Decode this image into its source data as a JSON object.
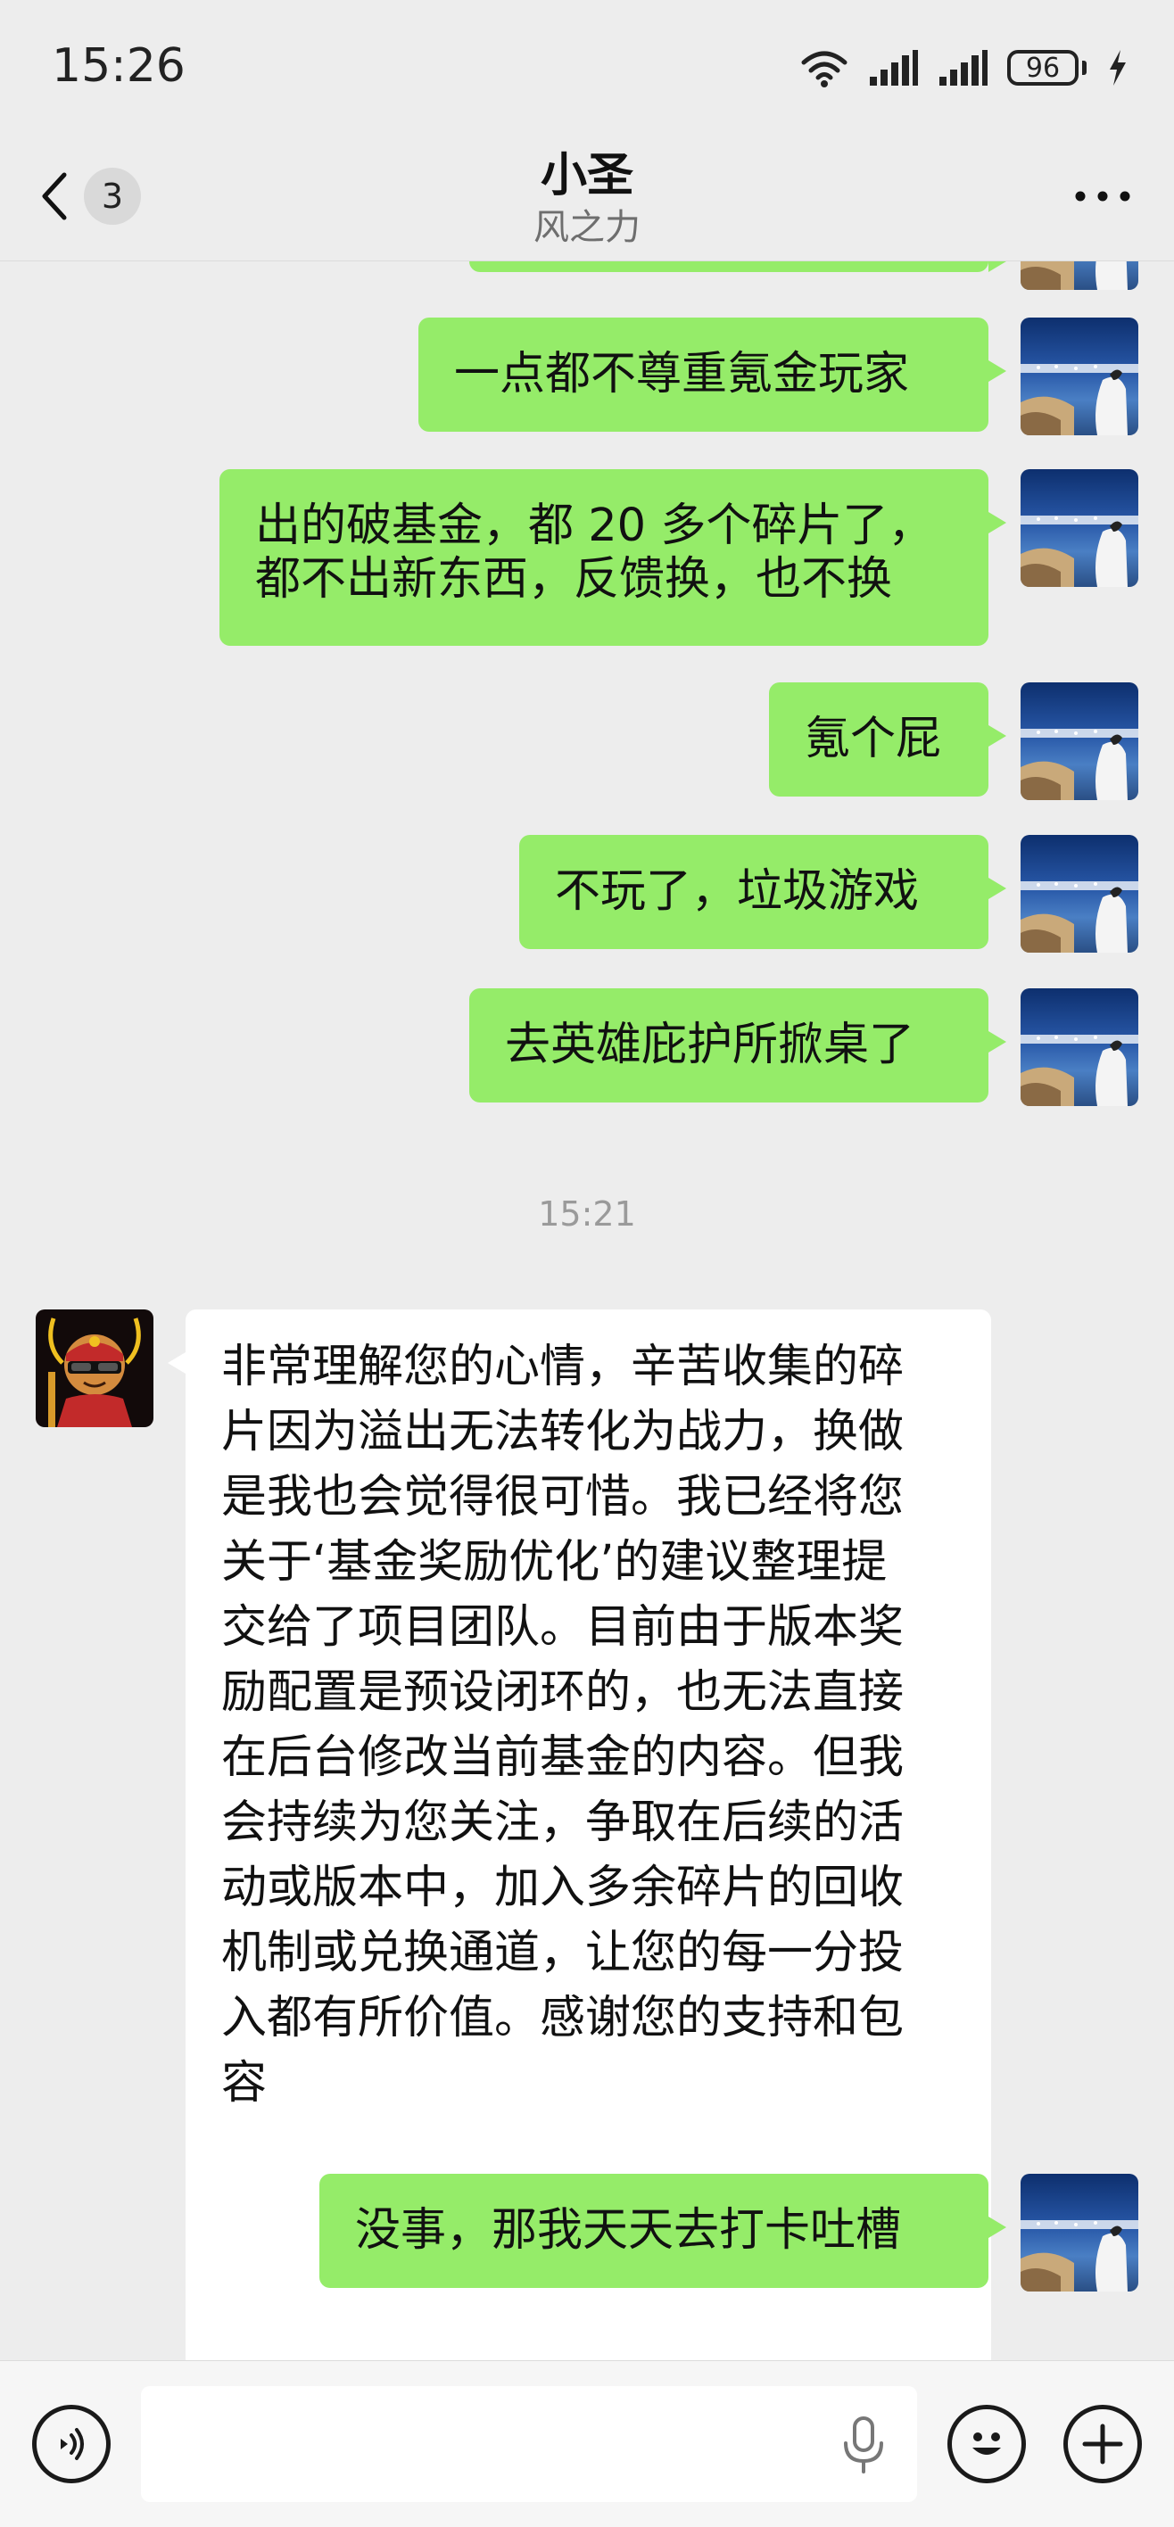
{
  "status_bar": {
    "time": "15:26",
    "battery_level": "96"
  },
  "header": {
    "unread_count": "3",
    "title": "小圣",
    "subtitle": "风之力"
  },
  "messages": [
    {
      "direction": "out",
      "text": "一点都不尊重氪金玩家"
    },
    {
      "direction": "out",
      "lines": [
        "出的破基金，都 20 多个碎片了，",
        "都不出新东西，反馈换，也不换"
      ]
    },
    {
      "direction": "out",
      "text": "氪个屁"
    },
    {
      "direction": "out",
      "text": "不玩了，垃圾游戏"
    },
    {
      "direction": "out",
      "text": "去英雄庇护所掀桌了"
    },
    {
      "direction": "in",
      "lines": [
        "非常理解您的心情，辛苦收集的碎",
        "片因为溢出无法转化为战力，换做",
        "是我也会觉得很可惜。我已经将您",
        "关于‘基金奖励优化’的建议整理提",
        "交给了项目团队。目前由于版本奖",
        "励配置是预设闭环的，也无法直接",
        "在后台修改当前基金的内容。但我",
        "会持续为您关注，争取在后续的活",
        "动或版本中，加入多余碎片的回收",
        "机制或兑换通道，让您的每一分投",
        "入都有所价值。感谢您的支持和包",
        "容"
      ]
    },
    {
      "direction": "out",
      "text": "没事，那我天天去打卡吐槽"
    }
  ],
  "timestamp": "15:21",
  "input": {
    "value": "",
    "placeholder": ""
  },
  "icons": {
    "back": "chevron-left-icon",
    "more": "more-dots-icon",
    "voice": "voice-toggle-icon",
    "mic": "microphone-icon",
    "emoji": "emoji-icon",
    "plus": "plus-icon",
    "wifi": "wifi-icon",
    "signal": "signal-icon",
    "charging": "charging-bolt-icon"
  },
  "colors": {
    "background": "#ededed",
    "outgoing_bubble": "#95ec69",
    "incoming_bubble": "#ffffff",
    "timestamp_text": "#9a9a9a"
  }
}
